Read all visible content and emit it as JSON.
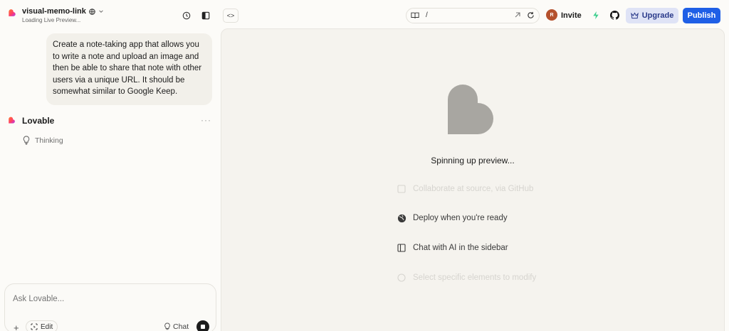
{
  "header": {
    "project_name": "visual-memo-link",
    "project_status": "Loading Live Preview...",
    "url_path": "/",
    "avatar_initial": "R",
    "invite_label": "Invite",
    "upgrade_label": "Upgrade",
    "publish_label": "Publish",
    "code_label": "<>"
  },
  "chat": {
    "user_message": "Create a note-taking app that allows you to write a note and upload an image and then be able to share that note with other users via a unique URL. It should be somewhat similar to Google Keep.",
    "assistant_name": "Lovable",
    "more_label": "···",
    "status_text": "Thinking",
    "composer_placeholder": "Ask Lovable...",
    "plus_label": "+",
    "edit_label": "Edit",
    "chat_label": "Chat"
  },
  "preview": {
    "loading_text": "Spinning up preview...",
    "features": [
      {
        "label": "Collaborate at source, via GitHub",
        "icon": "github-icon"
      },
      {
        "label": "Deploy when you're ready",
        "icon": "globe-icon"
      },
      {
        "label": "Chat with AI in the sidebar",
        "icon": "sidebar-icon"
      },
      {
        "label": "Select specific elements to modify",
        "icon": "cursor-icon"
      }
    ]
  },
  "colors": {
    "brand_gradient": [
      "#ff5a36",
      "#c03cf0"
    ],
    "publish": "#1f5fe6",
    "upgrade_bg": "#dfe3f6"
  }
}
